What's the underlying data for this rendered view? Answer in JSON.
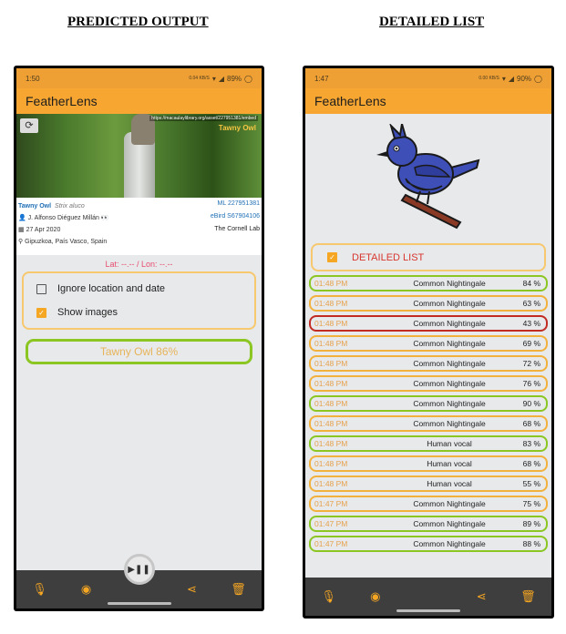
{
  "headings": {
    "left": "PREDICTED OUTPUT",
    "right": "DETAILED LIST"
  },
  "left_phone": {
    "status": {
      "time": "1:50",
      "battery": "89%",
      "signal": "0.04 KB/S"
    },
    "app_title": "FeatherLens",
    "photo": {
      "url": "https://macaulaylibrary.org/asset/227951381/embed",
      "species_tag": "Tawny Owl"
    },
    "meta": {
      "common_name": "Tawny Owl",
      "scientific_name": "Strix aluco",
      "ml_id": "ML 227951381",
      "author": "J. Alfonso Diéguez Millán 👀",
      "ebird_id": "eBird S67904106",
      "date": "27 Apr 2020",
      "location": "Gipuzkoa, País Vasco, Spain",
      "credit": "The Cornell Lab"
    },
    "latlon": "Lat: --.-- / Lon: --.--",
    "options": [
      {
        "label": "Ignore location and date",
        "checked": false
      },
      {
        "label": "Show images",
        "checked": true
      }
    ],
    "prediction": "Tawny Owl  86%",
    "play_icon": "play-pause-icon",
    "nav_icons": [
      "mic-icon",
      "eye-icon",
      "share-icon",
      "trash-icon"
    ]
  },
  "right_phone": {
    "status": {
      "time": "1:47",
      "battery": "90%",
      "signal": "0.00 KB/S"
    },
    "app_title": "FeatherLens",
    "logo_icon": "bird-logo-icon",
    "toggle_label": "DETAILED LIST",
    "items": [
      {
        "time": "01:48 PM",
        "name": "Common Nightingale",
        "pct": "84 %",
        "color": "green"
      },
      {
        "time": "01:48 PM",
        "name": "Common Nightingale",
        "pct": "63 %",
        "color": "orange"
      },
      {
        "time": "01:48 PM",
        "name": "Common Nightingale",
        "pct": "43 %",
        "color": "red"
      },
      {
        "time": "01:48 PM",
        "name": "Common Nightingale",
        "pct": "69 %",
        "color": "orange"
      },
      {
        "time": "01:48 PM",
        "name": "Common Nightingale",
        "pct": "72 %",
        "color": "orange"
      },
      {
        "time": "01:48 PM",
        "name": "Common Nightingale",
        "pct": "76 %",
        "color": "orange"
      },
      {
        "time": "01:48 PM",
        "name": "Common Nightingale",
        "pct": "90 %",
        "color": "green"
      },
      {
        "time": "01:48 PM",
        "name": "Common Nightingale",
        "pct": "68 %",
        "color": "orange"
      },
      {
        "time": "01:48 PM",
        "name": "Human vocal",
        "pct": "83 %",
        "color": "green"
      },
      {
        "time": "01:48 PM",
        "name": "Human vocal",
        "pct": "68 %",
        "color": "orange"
      },
      {
        "time": "01:48 PM",
        "name": "Human vocal",
        "pct": "55 %",
        "color": "orange"
      },
      {
        "time": "01:47 PM",
        "name": "Common Nightingale",
        "pct": "75 %",
        "color": "orange"
      },
      {
        "time": "01:47 PM",
        "name": "Common Nightingale",
        "pct": "89 %",
        "color": "green"
      },
      {
        "time": "01:47 PM",
        "name": "Common Nightingale",
        "pct": "88 %",
        "color": "green"
      }
    ],
    "nav_icons": [
      "mic-icon",
      "eye-icon",
      "share-icon",
      "trash-icon"
    ]
  },
  "colors": {
    "appbar": "#f7a631",
    "status": "#efa035",
    "good": "#8bc623",
    "mid": "#f2b13c",
    "low": "#c22b22",
    "nav": "#3e3e3e"
  }
}
